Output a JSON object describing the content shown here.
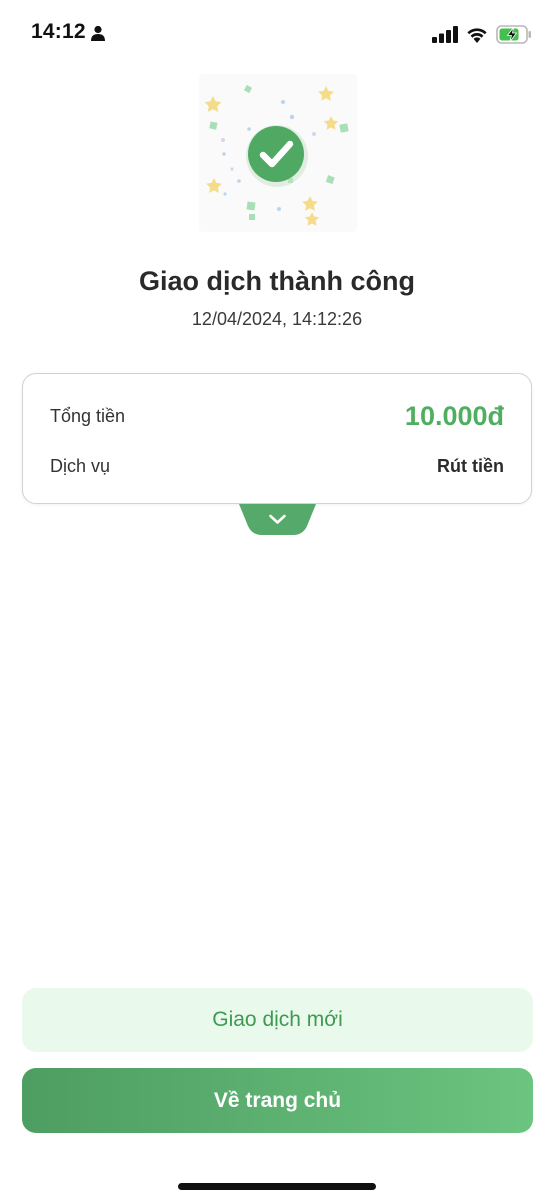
{
  "status_bar": {
    "time": "14:12"
  },
  "result": {
    "title": "Giao dịch thành công",
    "datetime": "12/04/2024, 14:12:26"
  },
  "summary": {
    "total_label": "Tổng tiền",
    "total_value": "10.000đ",
    "service_label": "Dịch vụ",
    "service_value": "Rút tiền"
  },
  "actions": {
    "new_transaction": "Giao dịch mới",
    "home": "Về trang chủ"
  },
  "colors": {
    "accent_green": "#4fae5f",
    "button_green_start": "#4e9d62",
    "button_green_end": "#6bc47f",
    "secondary_bg": "#e9faec"
  },
  "icons": [
    "person-icon",
    "signal-icon",
    "wifi-icon",
    "battery-charging-icon",
    "success-check-icon",
    "chevron-down-icon"
  ]
}
